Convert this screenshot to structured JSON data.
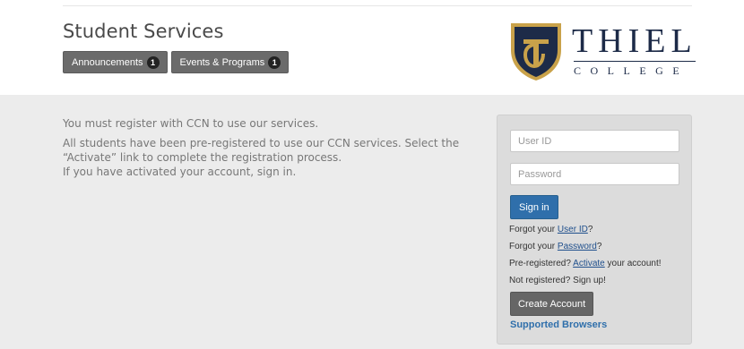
{
  "header": {
    "title": "Student Services",
    "buttons": [
      {
        "label": "Announcements",
        "count": "1"
      },
      {
        "label": "Events & Programs",
        "count": "1"
      }
    ]
  },
  "logo": {
    "name": "THIEL",
    "sub": "COLLEGE",
    "shield_color": "#1d2b48",
    "accent_color": "#c9a24a"
  },
  "intro": {
    "line1": "You must register with CCN to use our services.",
    "line2": "All students have been pre-registered to use our CCN services. Select the “Activate” link to complete the registration process.",
    "line3": "If you have activated your account, sign in."
  },
  "login": {
    "userid_placeholder": "User ID",
    "password_placeholder": "Password",
    "signin_label": "Sign in",
    "forgot_userid": {
      "before": "Forgot your ",
      "link": "User ID",
      "after": "?"
    },
    "forgot_password": {
      "before": "Forgot your ",
      "link": "Password",
      "after": "?"
    },
    "preregistered": {
      "before": "Pre-registered? ",
      "link": "Activate",
      "after": " your account!"
    },
    "not_registered": "Not registered? Sign up!",
    "create_label": "Create Account",
    "supported_label": "Supported Browsers"
  },
  "colors": {
    "primary_button": "#2f6fab",
    "secondary_button": "#666666",
    "panel_bg": "#dcdcdc",
    "band_bg": "#ececec"
  }
}
